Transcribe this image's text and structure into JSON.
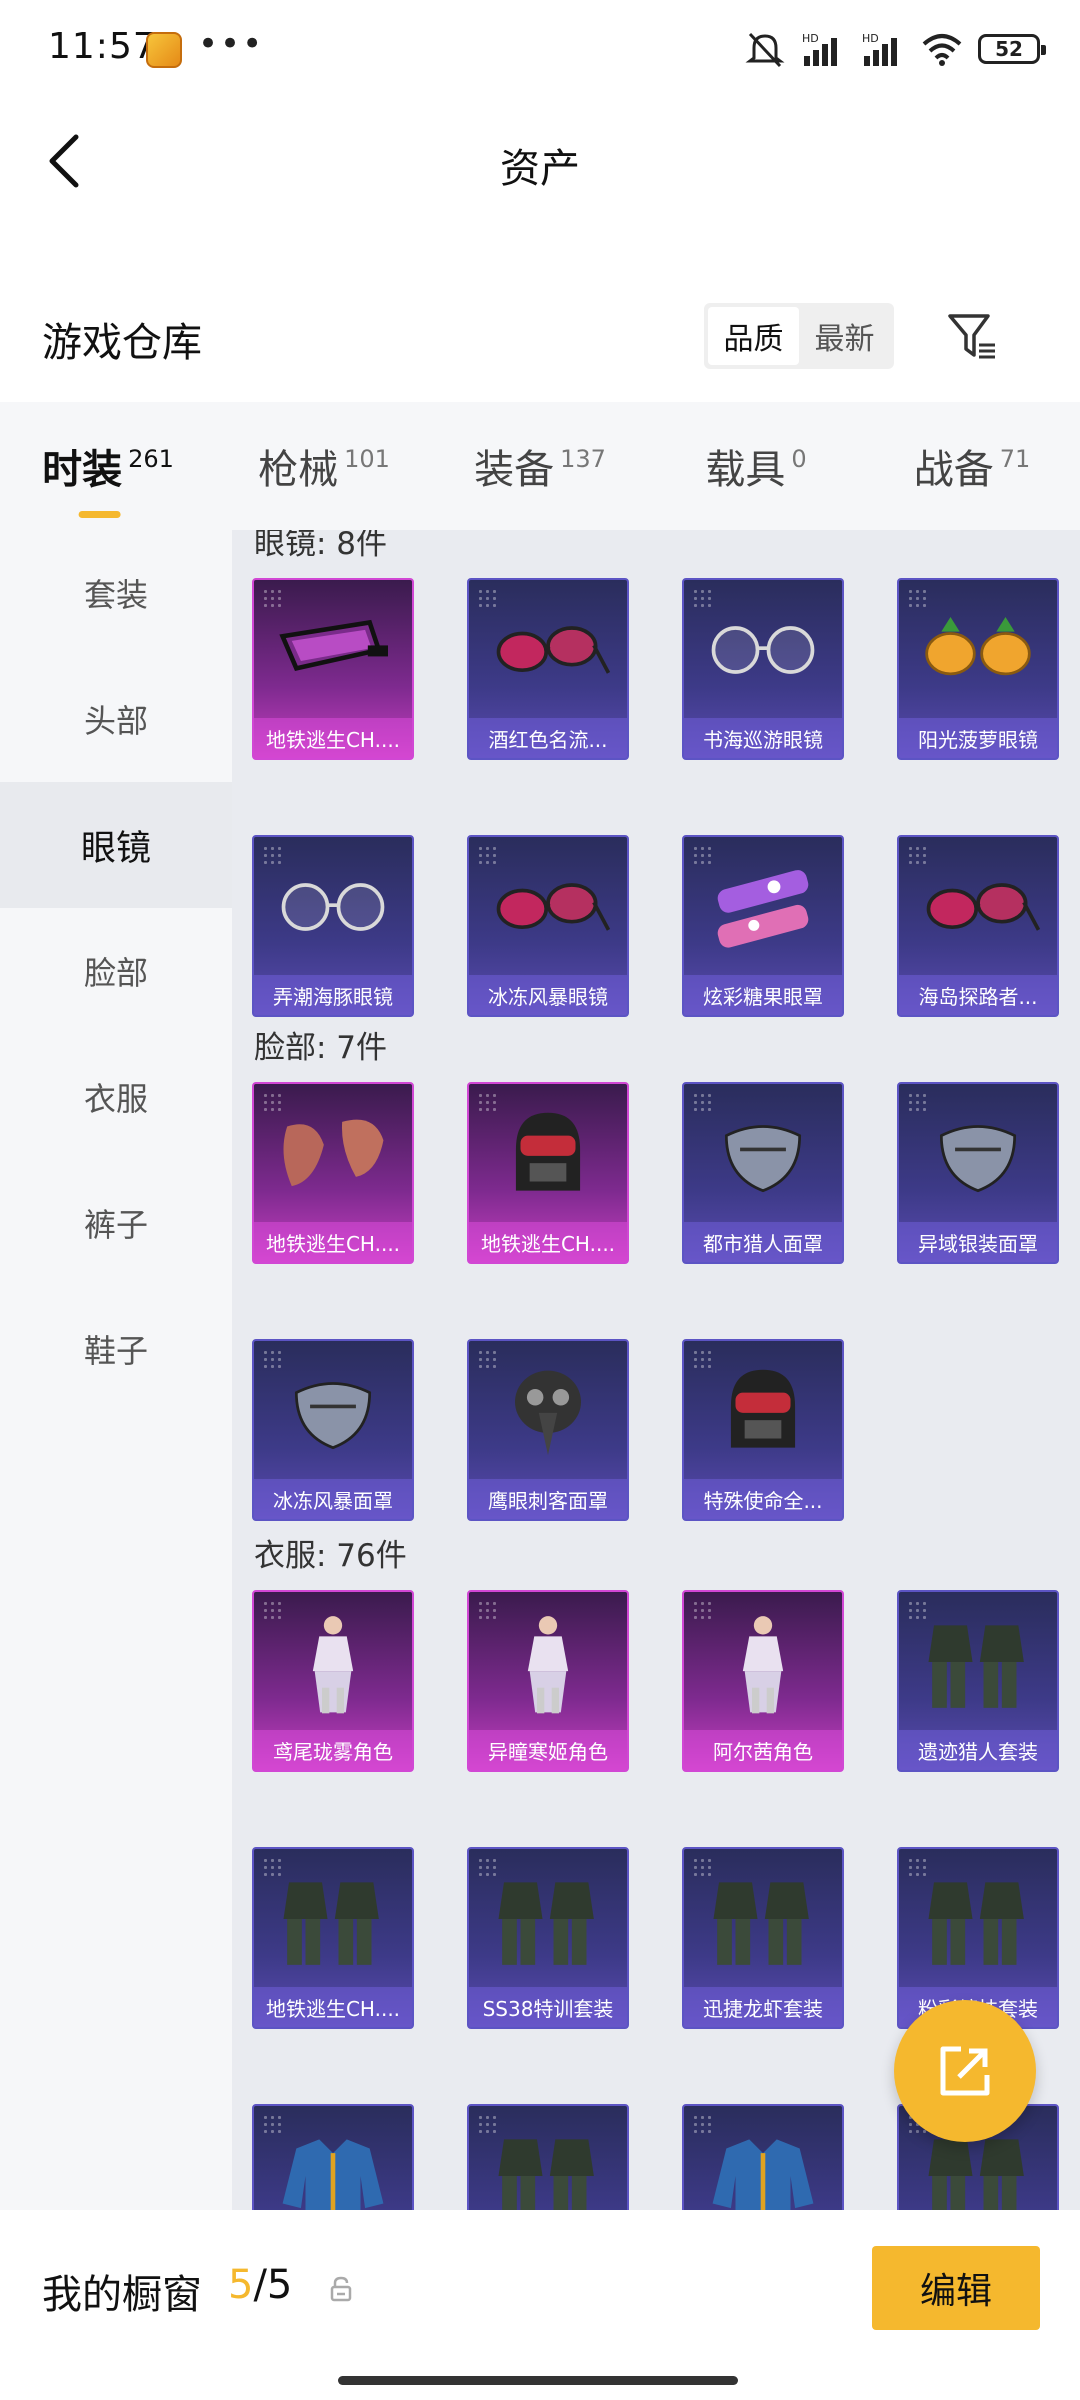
{
  "status": {
    "time": "11:57",
    "dots": "•••",
    "battery": "52",
    "icons": [
      "mute-icon",
      "hd-signal-icon",
      "hd-signal-icon",
      "wifi-icon",
      "battery-icon"
    ]
  },
  "header": {
    "title": "资产",
    "back_icon": "chevron-left-icon"
  },
  "warehouse": {
    "title": "游戏仓库",
    "sort_options": [
      "品质",
      "最新"
    ],
    "sort_selected": "品质",
    "filter_icon": "filter-icon"
  },
  "tabs": [
    {
      "label": "时装",
      "count": "261",
      "active": true
    },
    {
      "label": "枪械",
      "count": "101",
      "active": false
    },
    {
      "label": "装备",
      "count": "137",
      "active": false
    },
    {
      "label": "载具",
      "count": "0",
      "active": false
    },
    {
      "label": "战备",
      "count": "71",
      "active": false
    }
  ],
  "sidebar": [
    {
      "label": "套装",
      "active": false
    },
    {
      "label": "头部",
      "active": false
    },
    {
      "label": "眼镜",
      "active": true
    },
    {
      "label": "脸部",
      "active": false
    },
    {
      "label": "衣服",
      "active": false
    },
    {
      "label": "裤子",
      "active": false
    },
    {
      "label": "鞋子",
      "active": false
    }
  ],
  "sections": [
    {
      "title": "眼镜: 8件",
      "items": [
        {
          "name": "地铁逃生CH....",
          "rarity": "pink",
          "art": "goggles"
        },
        {
          "name": "酒红色名流...",
          "rarity": "purple",
          "art": "sunglasses"
        },
        {
          "name": "书海巡游眼镜",
          "rarity": "purple",
          "art": "round-glasses"
        },
        {
          "name": "阳光菠萝眼镜",
          "rarity": "purple",
          "art": "pineapple-glasses"
        },
        {
          "name": "弄潮海豚眼镜",
          "rarity": "purple",
          "art": "round-glasses"
        },
        {
          "name": "冰冻风暴眼镜",
          "rarity": "purple",
          "art": "sunglasses"
        },
        {
          "name": "炫彩糖果眼罩",
          "rarity": "purple",
          "art": "eyemask"
        },
        {
          "name": "海岛探路者...",
          "rarity": "purple",
          "art": "sunglasses"
        }
      ]
    },
    {
      "title": "脸部: 7件",
      "items": [
        {
          "name": "地铁逃生CH....",
          "rarity": "pink",
          "art": "bandana"
        },
        {
          "name": "地铁逃生CH....",
          "rarity": "pink",
          "art": "helmet"
        },
        {
          "name": "都市猎人面罩",
          "rarity": "purple",
          "art": "mask"
        },
        {
          "name": "异域银装面罩",
          "rarity": "purple",
          "art": "mask"
        },
        {
          "name": "冰冻风暴面罩",
          "rarity": "purple",
          "art": "mask"
        },
        {
          "name": "鹰眼刺客面罩",
          "rarity": "purple",
          "art": "plague-mask"
        },
        {
          "name": "特殊使命全...",
          "rarity": "purple",
          "art": "helmet"
        }
      ]
    },
    {
      "title": "衣服: 76件",
      "items": [
        {
          "name": "鸢尾珑雾角色",
          "rarity": "pink",
          "art": "character"
        },
        {
          "name": "异瞳寒姬角色",
          "rarity": "pink",
          "art": "character"
        },
        {
          "name": "阿尔茜角色",
          "rarity": "pink",
          "art": "character"
        },
        {
          "name": "遗迹猎人套装",
          "rarity": "purple",
          "art": "outfit"
        },
        {
          "name": "地铁逃生CH....",
          "rarity": "purple",
          "art": "outfit"
        },
        {
          "name": "SS38特训套装",
          "rarity": "purple",
          "art": "outfit"
        },
        {
          "name": "迅捷龙虾套装",
          "rarity": "purple",
          "art": "outfit"
        },
        {
          "name": "粉彩缠枝套装",
          "rarity": "purple",
          "art": "outfit"
        },
        {
          "name": "",
          "rarity": "purple",
          "art": "jacket"
        },
        {
          "name": "",
          "rarity": "purple",
          "art": "outfit"
        },
        {
          "name": "",
          "rarity": "purple",
          "art": "jacket"
        },
        {
          "name": "",
          "rarity": "purple",
          "art": "outfit"
        }
      ]
    }
  ],
  "fab": {
    "icon": "share-icon"
  },
  "bottom": {
    "label": "我的橱窗",
    "count_current": "5",
    "count_total": "/5",
    "lock_icon": "lock-icon",
    "edit_label": "编辑"
  },
  "colors": {
    "accent": "#f5b82e",
    "pink_border": "#d147d4",
    "purple_border": "#5c54c4"
  }
}
